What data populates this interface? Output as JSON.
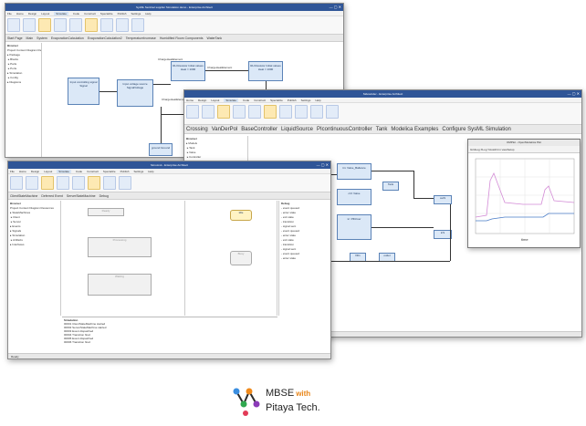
{
  "win1": {
    "title": "SysML Sentinel supplier Simulation demo - Enterprise Architect",
    "menu": [
      "File",
      "Home",
      "Design",
      "Layout",
      "Simulate",
      "Code",
      "Construct",
      "Specialize",
      "Publish",
      "Settings",
      "Help"
    ],
    "active_menu": "Simulate",
    "tabs": [
      "Start Page",
      "Main",
      "System",
      "EvaporationCalculation",
      "EvaporationCalculation2",
      "TemperatureIncrease",
      "Humidified Room Components",
      "WaterTank"
    ],
    "tree_header": "Browser",
    "tree_items": [
      "Project",
      "Context",
      "Diagram",
      "Resources"
    ],
    "blocks": [
      {
        "label": "Input controlling signal Signal"
      },
      {
        "label": "Input voltage source SignalVoltage"
      },
      {
        "label": "RH Resistor Initial values Heat = 1000"
      },
      {
        "label": "RH Resistor Initial values Heat = 1000"
      },
      {
        "label": "ground Ground"
      }
    ],
    "flow_labels": [
      "ChargeHeatElement",
      "ChargeHeatElement",
      "ChargeHeatElement",
      "ChargeHeatElement"
    ]
  },
  "win2": {
    "title": "Sidewinder - Enterprise Architect",
    "menu": [
      "Home",
      "Design",
      "Layout",
      "Simulate",
      "Code",
      "Construct",
      "Specialize",
      "Publish",
      "Settings",
      "Help"
    ],
    "active_menu": "Simulate",
    "tabs": [
      "Crossing",
      "VanDerPol",
      "BaseController",
      "LiquidSource",
      "PIcontinuousController",
      "Tank",
      "Modelica Examples",
      "Configure SysML Simulation"
    ],
    "tree_header": "Browser",
    "blocks": [
      {
        "label": "tin: Valve_Ballance"
      },
      {
        "label": "ctrl: Valve"
      },
      {
        "label": "tc: PIDriver"
      },
      {
        "label": "Tank"
      },
      {
        "label": "outS"
      },
      {
        "label": "inS"
      },
      {
        "label": "fillin"
      },
      {
        "label": "outlet"
      }
    ],
    "plot": {
      "title": "OMPlot - OpenModelica Plot",
      "xlabel": "time",
      "toolbar": [
        "Grid",
        "Log X",
        "Log Y",
        "Auto",
        "Fit in view",
        "Setup"
      ]
    },
    "status": "Executable State Machine Output"
  },
  "win3": {
    "title": "SimuLink - Enterprise Architect",
    "menu": [
      "File",
      "Home",
      "Design",
      "Layout",
      "Simulate",
      "Code",
      "Construct",
      "Specialize",
      "Publish",
      "Settings",
      "Help"
    ],
    "active_menu": "Simulate",
    "tabs": [
      "ClientStateMachine",
      "Deferred Event",
      "ServerStateMachine",
      "Debug"
    ],
    "tree_header": "Browser",
    "tree_items": [
      "Project",
      "Context",
      "Diagram",
      "Resources"
    ],
    "sim_panel": "Simulation",
    "states_left": [
      "Ready",
      "Processing",
      "Waiting"
    ],
    "states_right": [
      "Idle",
      "Busy"
    ],
    "debug_header": "Debug",
    "status": "Ready"
  },
  "brand": {
    "line1": "MBSE",
    "with": "with",
    "line2": "Pitaya Tech."
  },
  "colors": {
    "titlebar": "#2f5597",
    "block": "#dbe8f7",
    "state": "#fff3c4",
    "accent": "#e8861a"
  }
}
